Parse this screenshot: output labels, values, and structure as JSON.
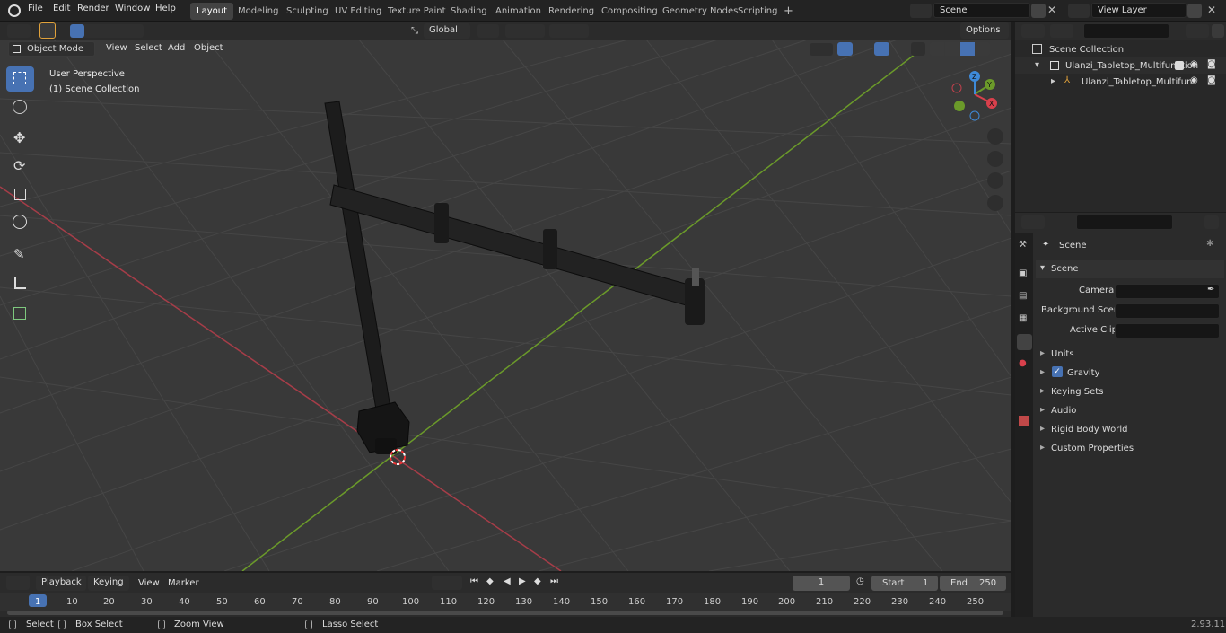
{
  "menubar": {
    "items": [
      "File",
      "Edit",
      "Render",
      "Window",
      "Help"
    ],
    "workspaces": [
      "Layout",
      "Modeling",
      "Sculpting",
      "UV Editing",
      "Texture Paint",
      "Shading",
      "Animation",
      "Rendering",
      "Compositing",
      "Geometry Nodes",
      "Scripting"
    ],
    "active_workspace": "Layout",
    "add_tab": "+",
    "scene_name": "Scene",
    "view_layer_name": "View Layer"
  },
  "viewport_header": {
    "mode": "Object Mode",
    "menus": [
      "View",
      "Select",
      "Add",
      "Object"
    ],
    "orientation": "Global",
    "options": "Options"
  },
  "viewport": {
    "perspective_label": "User Perspective",
    "collection_label": "(1) Scene Collection",
    "gizmo_axes": [
      "X",
      "Y",
      "Z"
    ]
  },
  "outliner": {
    "root": "Scene Collection",
    "items": [
      {
        "label": "Ulanzi_Tabletop_Multifunction",
        "level": 1
      },
      {
        "label": "Ulanzi_Tabletop_Multifun",
        "level": 2
      }
    ]
  },
  "properties": {
    "context": "Scene",
    "panel": "Scene",
    "fields": [
      {
        "label": "Camera",
        "value": ""
      },
      {
        "label": "Background Scene",
        "value": ""
      },
      {
        "label": "Active Clip",
        "value": ""
      }
    ],
    "sections": [
      "Units",
      "Gravity",
      "Keying Sets",
      "Audio",
      "Rigid Body World",
      "Custom Properties"
    ],
    "gravity_checked": true
  },
  "timeline": {
    "menus": [
      "Playback",
      "Keying",
      "View",
      "Marker"
    ],
    "current_frame": "1",
    "start_label": "Start",
    "start": "1",
    "end_label": "End",
    "end": "250",
    "ruler": [
      "1",
      "10",
      "20",
      "30",
      "40",
      "50",
      "60",
      "70",
      "80",
      "90",
      "100",
      "110",
      "120",
      "130",
      "140",
      "150",
      "160",
      "170",
      "180",
      "190",
      "200",
      "210",
      "220",
      "230",
      "240",
      "250"
    ]
  },
  "statusbar": {
    "items": [
      "Select",
      "Box Select",
      "Zoom View",
      "Lasso Select"
    ],
    "version": "2.93.11"
  },
  "colors": {
    "accent": "#4772b3",
    "x_axis": "#a63d48",
    "y_axis": "#6b9a2a",
    "viewport_bg": "#393939"
  }
}
